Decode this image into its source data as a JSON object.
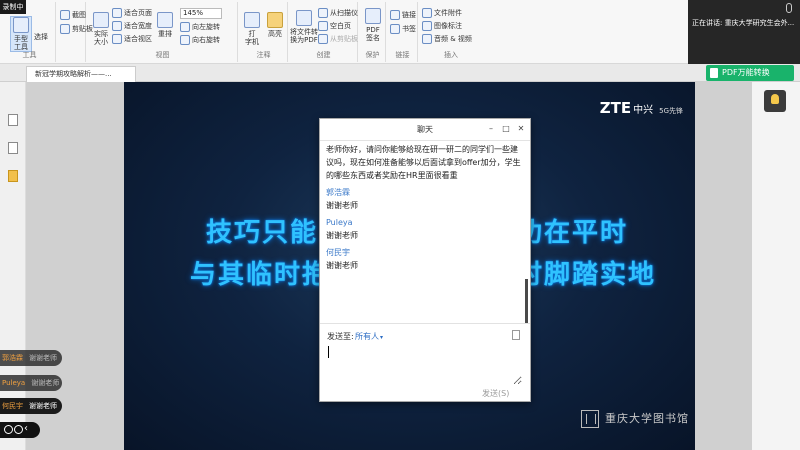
{
  "recorder": {
    "badge": "录制中"
  },
  "ribbon": {
    "hand_tool": "手型\n工具",
    "select": "选择",
    "group_tools": "工具",
    "screenshot": "截图",
    "clipboard": "剪贴板",
    "actual_size": "实际\n大小",
    "fit_page": "适合页面",
    "fit_width": "适合宽度",
    "fit_visible": "适合视区",
    "reflow": "重排",
    "zoom": "145%",
    "rotate_left": "向左旋转",
    "rotate_right": "向右旋转",
    "group_view": "视图",
    "typewriter": "打\n字机",
    "highlight": "高亮",
    "group_comment": "注释",
    "convert_pdf": "将文件转\n换为PDF",
    "from_scanner": "从扫描仪",
    "blank_page": "空白页",
    "from_clipboard": "从剪贴板",
    "group_create": "创建",
    "pdf_sign": "PDF\n签名",
    "group_protect": "保护",
    "link": "链接",
    "bookmark": "书签",
    "group_links": "链接",
    "file_attach": "文件附件",
    "image_annot": "图像标注",
    "audio_video": "音频 & 视频",
    "group_insert": "插入"
  },
  "status": {
    "speaker": "正在讲话: 重庆大学研究生会外..."
  },
  "tabs": {
    "doc_tab": "新冠学期攻略解析——...",
    "pdf_convert": "PDF万能转换"
  },
  "slide": {
    "logo_main": "ZTE",
    "logo_cn": "中兴",
    "logo_tag": "5G先锋",
    "line1_left": "技巧只能",
    "line1_right": "功在平时",
    "line2_left": "与其临时抱",
    "line2_right": "时脚踏实地",
    "library": "重庆大学图书馆"
  },
  "chat": {
    "title": "聊天",
    "messages": [
      {
        "sender": "",
        "text": "老师你好，请问你能够给现在研一研二的同学们一些建议吗，现在如何准备能够以后面试拿到offer加分，学生的哪些东西或者奖励在HR里面很看重"
      },
      {
        "sender": "郭浩霖",
        "text": "谢谢老师"
      },
      {
        "sender": "Puleya",
        "text": "谢谢老师"
      },
      {
        "sender": "何民宇",
        "text": "谢谢老师"
      }
    ],
    "send_to_label": "发送至:",
    "recipient": "所有人",
    "input_value": "",
    "send_button": "发送(S)"
  },
  "danmaku": [
    {
      "name": "郭浩霖",
      "text": "谢谢老师"
    },
    {
      "name": "Puleya",
      "text": "谢谢老师"
    },
    {
      "name": "何民宇",
      "text": "谢谢老师"
    }
  ]
}
